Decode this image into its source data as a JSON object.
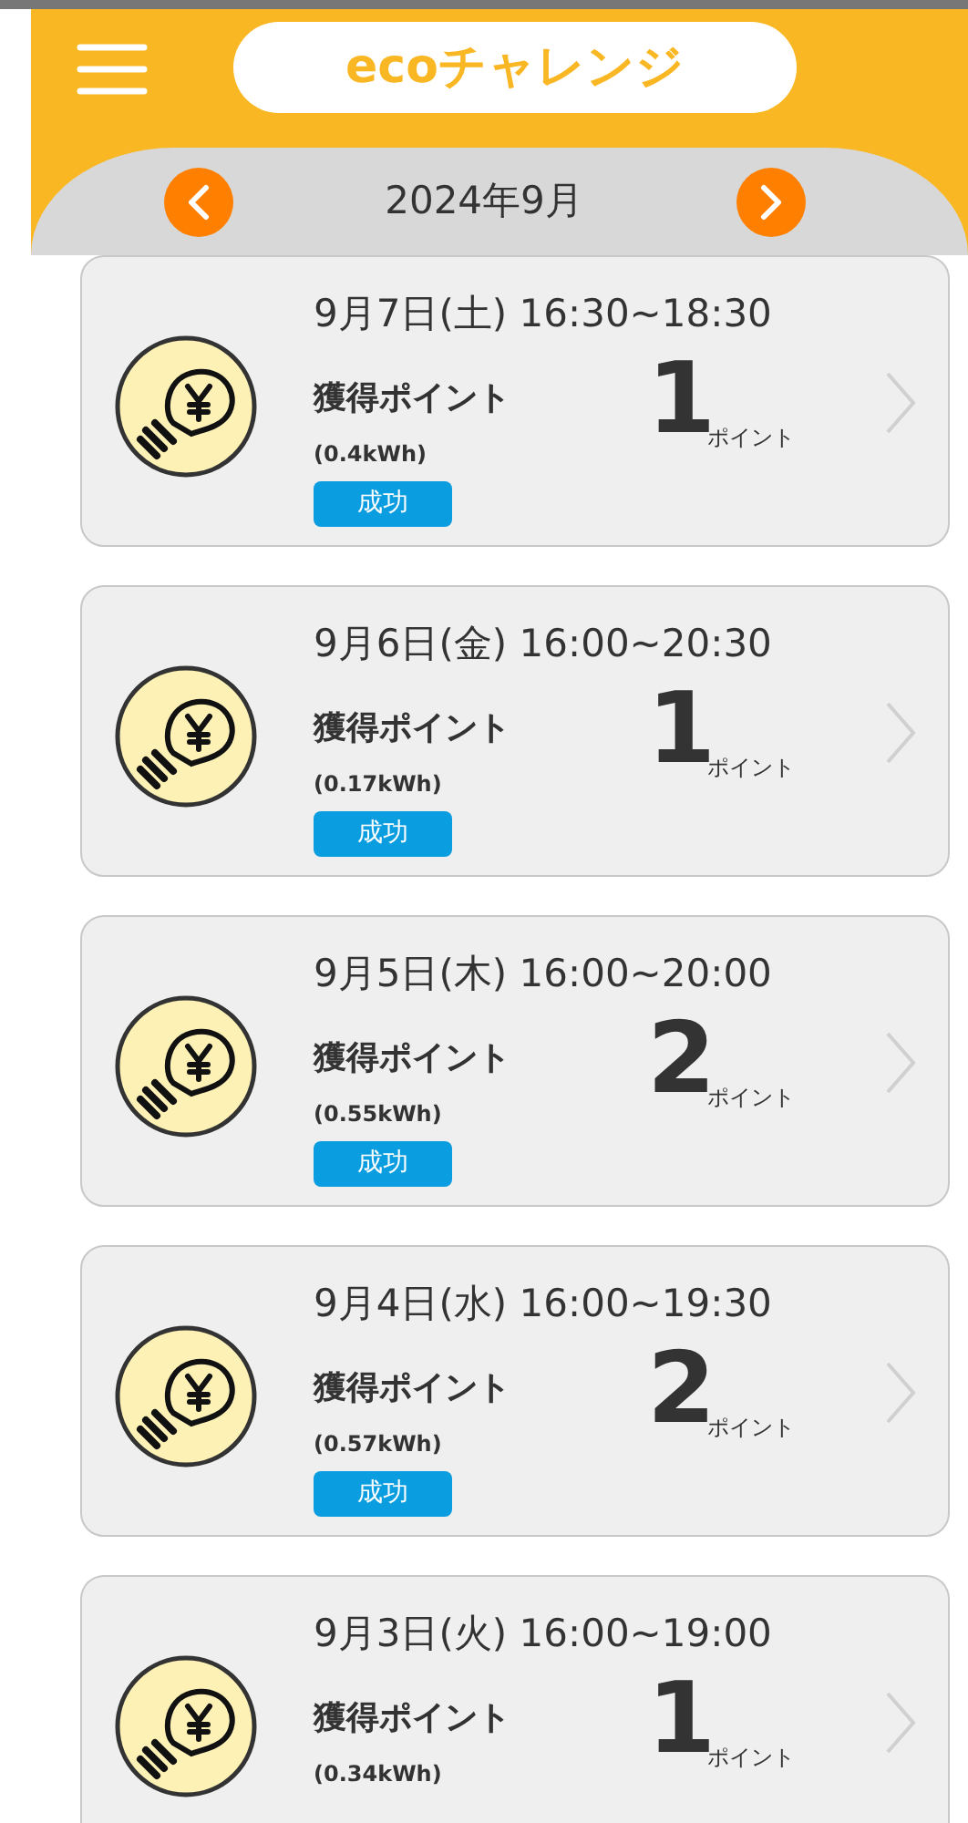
{
  "header": {
    "title": "ecoチャレンジ"
  },
  "month_nav": {
    "label": "2024年9月"
  },
  "cards": [
    {
      "date": "9月7日(土) 16:30~18:30",
      "label": "獲得ポイント",
      "energy": "(0.4kWh)",
      "status": "成功",
      "points": "1",
      "unit": "ポイント"
    },
    {
      "date": "9月6日(金) 16:00~20:30",
      "label": "獲得ポイント",
      "energy": "(0.17kWh)",
      "status": "成功",
      "points": "1",
      "unit": "ポイント"
    },
    {
      "date": "9月5日(木) 16:00~20:00",
      "label": "獲得ポイント",
      "energy": "(0.55kWh)",
      "status": "成功",
      "points": "2",
      "unit": "ポイント"
    },
    {
      "date": "9月4日(水) 16:00~19:30",
      "label": "獲得ポイント",
      "energy": "(0.57kWh)",
      "status": "成功",
      "points": "2",
      "unit": "ポイント"
    },
    {
      "date": "9月3日(火) 16:00~19:00",
      "label": "獲得ポイント",
      "energy": "(0.34kWh)",
      "points": "1",
      "unit": "ポイント"
    }
  ]
}
